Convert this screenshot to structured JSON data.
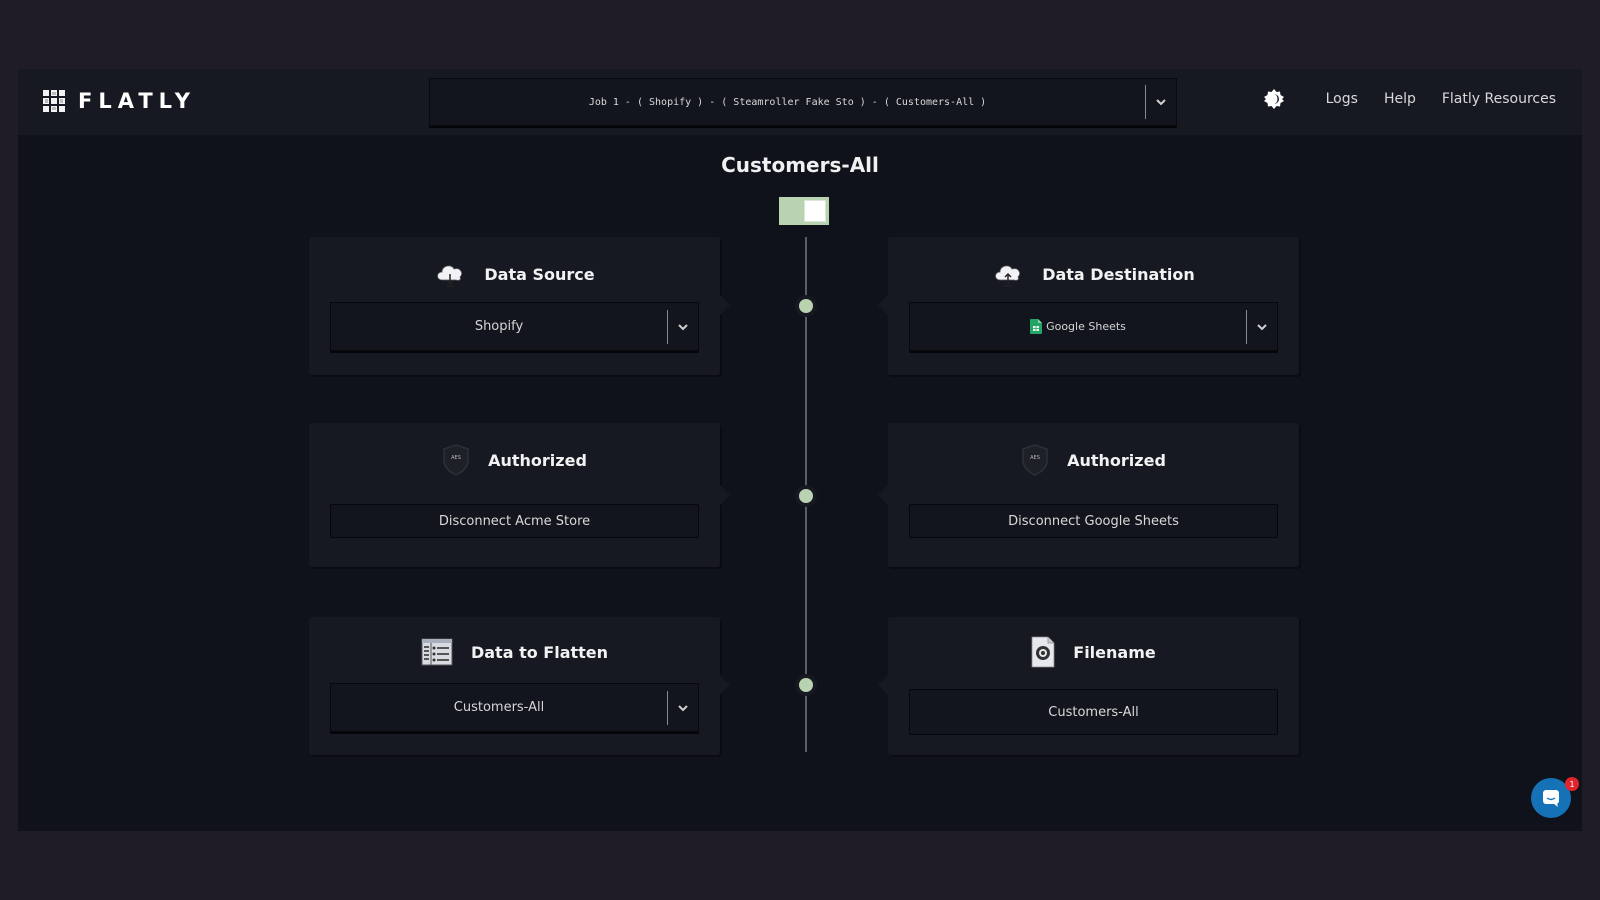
{
  "app": {
    "logo_text": "FLATLY"
  },
  "header": {
    "job_selector": {
      "value": "Job 1 - ( Shopify ) - ( Steamroller Fake Sto ) - ( Customers-All )"
    },
    "nav": {
      "theme_icon": "brightness-icon",
      "links": [
        "Logs",
        "Help",
        "Flatly Resources"
      ]
    }
  },
  "main": {
    "title": "Customers-All",
    "toggle": {
      "state": "on",
      "color": "#b9d3b0"
    },
    "left_cards": [
      {
        "icon": "cloud-download-icon",
        "title": "Data Source",
        "select_value": "Shopify"
      },
      {
        "icon": "aes-shield-icon",
        "icon_text": "AES",
        "title": "Authorized",
        "button_label": "Disconnect Acme Store"
      },
      {
        "icon": "table-list-icon",
        "title": "Data to Flatten",
        "select_value": "Customers-All"
      }
    ],
    "right_cards": [
      {
        "icon": "cloud-upload-icon",
        "title": "Data Destination",
        "select_value": "Google Sheets"
      },
      {
        "icon": "aes-shield-icon",
        "icon_text": "AES",
        "title": "Authorized",
        "button_label": "Disconnect Google Sheets"
      },
      {
        "icon": "file-gear-icon",
        "title": "Filename",
        "field_value": "Customers-All"
      }
    ]
  },
  "chat_widget": {
    "badge_count": "1",
    "color": "#1572b6"
  }
}
